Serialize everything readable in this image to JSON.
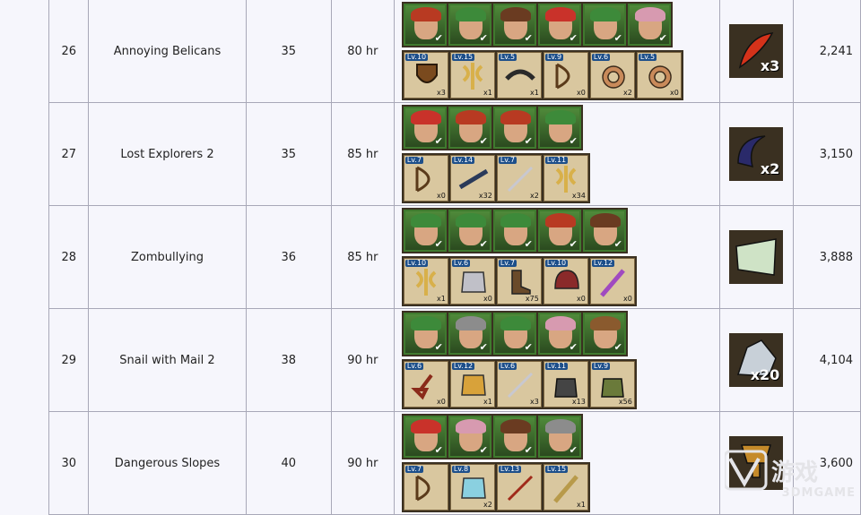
{
  "rows": [
    {
      "num": "26",
      "name": "Annoying Belicans",
      "level": "35",
      "time": "80 hr",
      "cost": "2,241",
      "heroes": [
        "red-haired hero",
        "green-haired hero",
        "bearded hero",
        "santa-hat hero",
        "green-haired hero",
        "pink-haired hero"
      ],
      "items": [
        {
          "icon": "shield-icon",
          "lv": "Lv.10",
          "count": "x3"
        },
        {
          "icon": "axe-icon",
          "lv": "Lv.15",
          "count": "x1"
        },
        {
          "icon": "boomerang-icon",
          "lv": "Lv.5",
          "count": "x1"
        },
        {
          "icon": "bow-icon",
          "lv": "Lv.9",
          "count": "x0"
        },
        {
          "icon": "ring-icon",
          "lv": "Lv.6",
          "count": "x2"
        },
        {
          "icon": "ring-icon",
          "lv": "Lv.5",
          "count": "x0"
        }
      ],
      "reward": {
        "icon": "phoenix-feather-icon",
        "qty": "x3",
        "color": "#d4321a"
      }
    },
    {
      "num": "27",
      "name": "Lost Explorers 2",
      "level": "35",
      "time": "85 hr",
      "cost": "3,150",
      "heroes": [
        "santa-hat hero",
        "red-haired hero",
        "red-hat hero",
        "green-haired hero"
      ],
      "items": [
        {
          "icon": "crossbow-icon",
          "lv": "Lv.7",
          "count": "x0"
        },
        {
          "icon": "musket-icon",
          "lv": "Lv.14",
          "count": "x32"
        },
        {
          "icon": "sword-icon",
          "lv": "Lv.7",
          "count": "x2"
        },
        {
          "icon": "double-axe-icon",
          "lv": "Lv.11",
          "count": "x34"
        }
      ],
      "reward": {
        "icon": "horn-icon",
        "qty": "x2",
        "color": "#2a2a6a"
      }
    },
    {
      "num": "28",
      "name": "Zombullying",
      "level": "36",
      "time": "85 hr",
      "cost": "3,888",
      "heroes": [
        "green-haired hero",
        "green-haired hero",
        "green-haired hero",
        "red-haired hero",
        "bearded hero"
      ],
      "items": [
        {
          "icon": "axe-icon",
          "lv": "Lv.10",
          "count": "x1"
        },
        {
          "icon": "armor-icon",
          "lv": "Lv.6",
          "count": "x0"
        },
        {
          "icon": "boots-icon",
          "lv": "Lv.7",
          "count": "x75"
        },
        {
          "icon": "helmet-icon",
          "lv": "Lv.10",
          "count": "x0"
        },
        {
          "icon": "staff-icon",
          "lv": "Lv.12",
          "count": "x0"
        }
      ],
      "reward": {
        "icon": "star-map-icon",
        "qty": "",
        "color": "#cfe3c6"
      }
    },
    {
      "num": "29",
      "name": "Snail with Mail 2",
      "level": "38",
      "time": "90 hr",
      "cost": "4,104",
      "heroes": [
        "green-haired hero",
        "helmet hero",
        "green-haired hero",
        "pink-haired hero",
        "brown-haired hero"
      ],
      "items": [
        {
          "icon": "shovel-icon",
          "lv": "Lv.6",
          "count": "x0"
        },
        {
          "icon": "gold-armor-icon",
          "lv": "Lv.12",
          "count": "x1"
        },
        {
          "icon": "throwing-blade-icon",
          "lv": "Lv.6",
          "count": "x3"
        },
        {
          "icon": "gauntlet-icon",
          "lv": "Lv.11",
          "count": "x13"
        },
        {
          "icon": "glove-icon",
          "lv": "Lv.9",
          "count": "x56"
        }
      ],
      "reward": {
        "icon": "crystal-ore-icon",
        "qty": "x20",
        "color": "#c8d0d8"
      }
    },
    {
      "num": "30",
      "name": "Dangerous Slopes",
      "level": "40",
      "time": "90 hr",
      "cost": "3,600",
      "heroes": [
        "santa-hat hero",
        "pink-haired hero",
        "bearded hero",
        "helmet hero"
      ],
      "items": [
        {
          "icon": "bow-icon",
          "lv": "Lv.7",
          "count": ""
        },
        {
          "icon": "ice-armor-icon",
          "lv": "Lv.8",
          "count": "x2"
        },
        {
          "icon": "red-blade-icon",
          "lv": "Lv.13",
          "count": ""
        },
        {
          "icon": "scepter-icon",
          "lv": "Lv.15",
          "count": "x1"
        }
      ],
      "reward": {
        "icon": "golden-trophy-icon",
        "qty": "",
        "color": "#c58a2a"
      }
    }
  ],
  "watermark": {
    "text": "3DMGAME"
  }
}
